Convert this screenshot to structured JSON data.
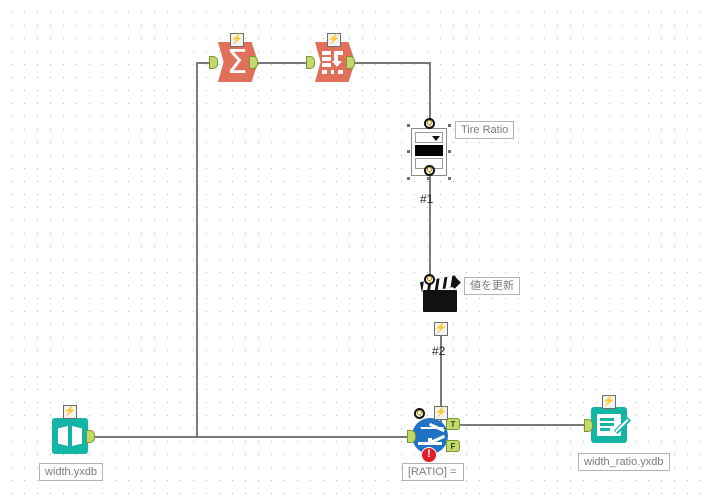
{
  "app": {
    "type": "workflow-canvas",
    "grid_spacing_px": 13,
    "canvas_bg": "#ffffff",
    "grid_dot_color": "#b9b9b9"
  },
  "colors": {
    "orange_tool": "#e0705a",
    "teal_tool": "#13b5a5",
    "filter_blue": "#1f72c4",
    "anchor_green": "#c2d96b",
    "anchor_green_border": "#7d9430",
    "wire": "#7a7a7a",
    "error_red": "#e01e26",
    "label_text": "#7c7c7c",
    "label_border": "#b3b3b3"
  },
  "tools": {
    "summarize": {
      "name": "Summarize",
      "glyph": "sigma-icon",
      "symbol": "Σ",
      "badge": "lightning-bolt",
      "badge_symbol": "⚡"
    },
    "transpose": {
      "name": "Transpose",
      "glyph": "transpose-icon",
      "badge": "lightning-bolt",
      "badge_symbol": "⚡"
    },
    "dropdown": {
      "name": "Drop Down interface tool",
      "label": "Tire Ratio",
      "selected": true,
      "question_badge": "question-anchor",
      "badge_symbol": "Q"
    },
    "action": {
      "name": "Action",
      "glyph": "clapperboard-icon",
      "label": "値を更新",
      "badge": "lightning-bolt",
      "badge_symbol": "⚡",
      "question_badge_symbol": "Q"
    },
    "filter": {
      "name": "Filter",
      "glyph": "filter-funnel-icon",
      "label": "[RATIO] =",
      "true_anchor": "T",
      "false_anchor": "F",
      "error_badge": "!",
      "badge": "lightning-bolt",
      "badge_symbol": "⚡",
      "question_badge_symbol": "Q"
    },
    "input_data": {
      "name": "Input Data",
      "glyph": "open-book-icon",
      "label": "width.yxdb",
      "badge": "lightning-bolt",
      "badge_symbol": "⚡"
    },
    "output_data": {
      "name": "Output Data",
      "glyph": "document-pencil-icon",
      "label": "width_ratio.yxdb",
      "badge": "lightning-bolt",
      "badge_symbol": "⚡"
    }
  },
  "connection_labels": {
    "c1": "#1",
    "c2": "#2"
  }
}
